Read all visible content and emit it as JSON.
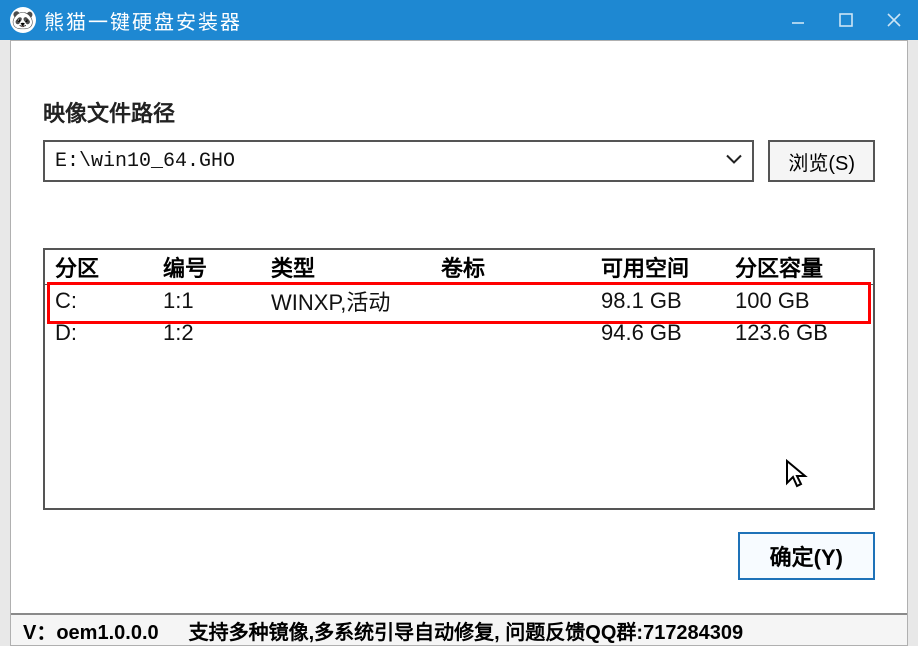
{
  "titlebar": {
    "app_title": "熊猫一键硬盘安装器"
  },
  "image_section": {
    "label": "映像文件路径",
    "path": "E:\\win10_64.GHO",
    "browse_btn": "浏览(S)"
  },
  "partitions": {
    "headers": [
      "分区",
      "编号",
      "类型",
      "卷标",
      "可用空间",
      "分区容量"
    ],
    "rows": [
      {
        "drive": "C:",
        "index": "1:1",
        "type": "WINXP,活动",
        "label": "",
        "free": "98.1 GB",
        "total": "100 GB",
        "highlight": true
      },
      {
        "drive": "D:",
        "index": "1:2",
        "type": "",
        "label": "",
        "free": "94.6 GB",
        "total": "123.6 GB",
        "highlight": false
      }
    ]
  },
  "confirm_btn": "确定(Y)",
  "footer": {
    "version": "V：oem1.0.0.0",
    "note": "支持多种镜像,多系统引导自动修复, 问题反馈QQ群:717284309"
  }
}
